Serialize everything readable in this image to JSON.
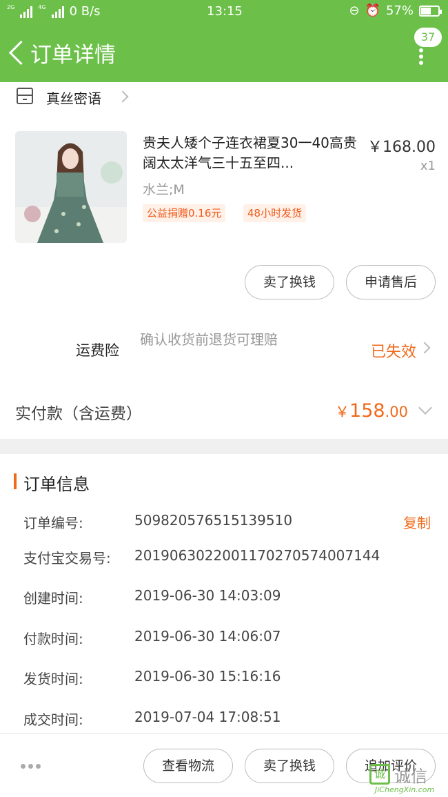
{
  "status_bar": {
    "network_small": "2G",
    "network_small2": "4G",
    "speed": "0 B/s",
    "time": "13:15",
    "battery_text": "57%",
    "battery_level": 0.57
  },
  "header": {
    "title": "订单详情",
    "badge_count": "37"
  },
  "shop": {
    "name": "真丝密语"
  },
  "product": {
    "title": "贵夫人矮个子连衣裙夏30一40高贵阔太太洋气三十五至四...",
    "price": "￥168.00",
    "qty": "x1",
    "sku": "水兰;M",
    "tags": [
      "公益捐赠0.16元",
      "48小时发货"
    ]
  },
  "actions": {
    "sell": "卖了换钱",
    "after_sale": "申请售后"
  },
  "insurance": {
    "label": "运费险",
    "desc": "确认收货前退货可理赔",
    "status": "已失效"
  },
  "payment": {
    "label": "实付款（含运费）",
    "currency": "￥",
    "amount_int": "158",
    "amount_dec": ".00"
  },
  "order_info": {
    "title": "订单信息",
    "copy": "复制",
    "rows": [
      {
        "label": "订单编号:",
        "value": "509820576515139510"
      },
      {
        "label": "支付宝交易号:",
        "value": "2019063022001170270574007144"
      },
      {
        "label": "创建时间:",
        "value": "2019-06-30 14:03:09"
      },
      {
        "label": "付款时间:",
        "value": "2019-06-30 14:06:07"
      },
      {
        "label": "发货时间:",
        "value": "2019-06-30 15:16:16"
      },
      {
        "label": "成交时间:",
        "value": "2019-07-04 17:08:51"
      }
    ]
  },
  "bottom": {
    "logistics": "查看物流",
    "sell": "卖了换钱",
    "review": "追加评价"
  },
  "watermark": {
    "box": "诚",
    "cn": "诚信",
    "en": "JiChengXin.com"
  }
}
